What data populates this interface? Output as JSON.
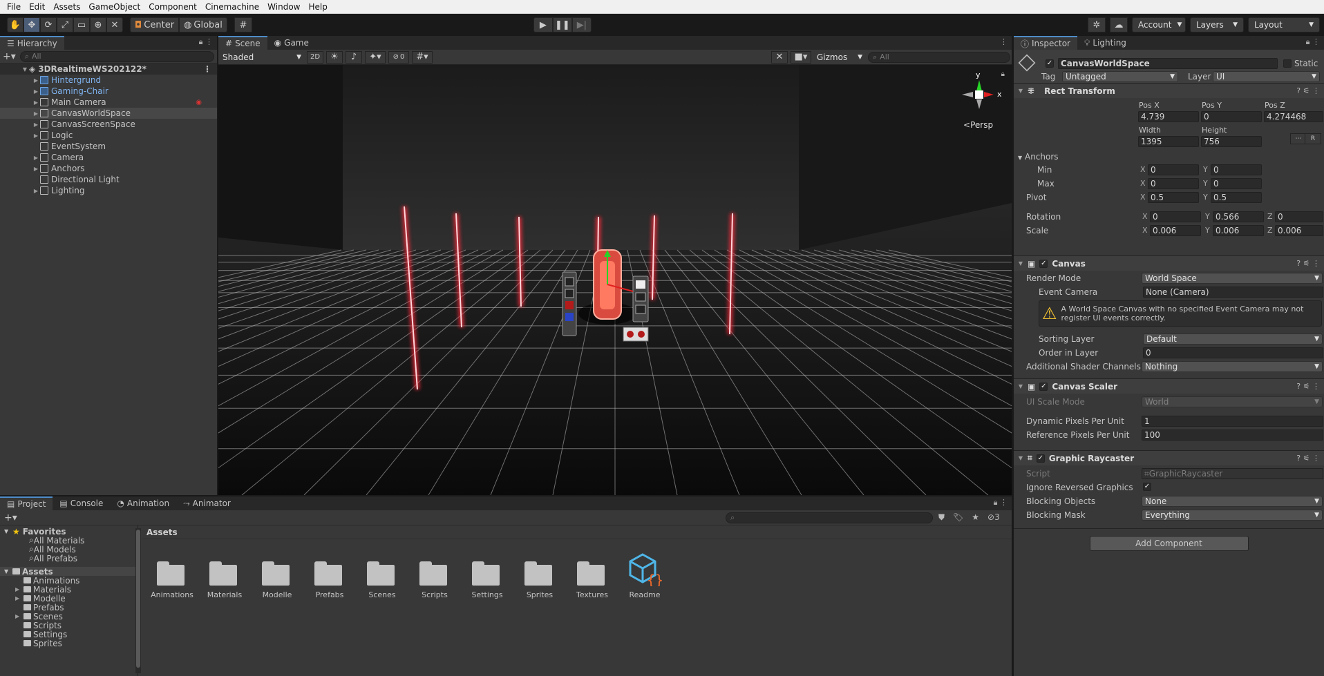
{
  "menubar": [
    "File",
    "Edit",
    "Assets",
    "GameObject",
    "Component",
    "Cinemachine",
    "Window",
    "Help"
  ],
  "toolbar": {
    "pivot": "Center",
    "space": "Global",
    "account": "Account",
    "layers": "Layers",
    "layout": "Layout"
  },
  "hierarchy": {
    "tab": "Hierarchy",
    "search_placeholder": "All",
    "scene": "3DRealtimeWS202122*",
    "items": [
      {
        "label": "Hintergrund",
        "prefab": true
      },
      {
        "label": "Gaming-Chair",
        "prefab": true
      },
      {
        "label": "Main Camera",
        "prefab": false
      },
      {
        "label": "CanvasWorldSpace",
        "prefab": false
      },
      {
        "label": "CanvasScreenSpace",
        "prefab": false
      },
      {
        "label": "Logic",
        "prefab": false
      },
      {
        "label": "EventSystem",
        "prefab": false
      },
      {
        "label": "Camera",
        "prefab": false
      },
      {
        "label": "Anchors",
        "prefab": false
      },
      {
        "label": "Directional Light",
        "prefab": false
      },
      {
        "label": "Lighting",
        "prefab": false
      }
    ]
  },
  "scene": {
    "tab_scene": "Scene",
    "tab_game": "Game",
    "shading": "Shaded",
    "mode2d": "2D",
    "hidden_count": "0",
    "gizmos": "Gizmos",
    "search_placeholder": "All",
    "persp": "Persp",
    "axis_x": "x",
    "axis_y": "y"
  },
  "inspector": {
    "tab": "Inspector",
    "tab2": "Lighting",
    "object_name": "CanvasWorldSpace",
    "static": "Static",
    "tag_label": "Tag",
    "tag": "Untagged",
    "layer_label": "Layer",
    "layer": "UI",
    "rect": {
      "title": "Rect Transform",
      "posx_l": "Pos X",
      "posy_l": "Pos Y",
      "posz_l": "Pos Z",
      "posx": "4.739",
      "posy": "0",
      "posz": "4.274468",
      "width_l": "Width",
      "height_l": "Height",
      "width": "1395",
      "height": "756",
      "r": "R",
      "anchors": "Anchors",
      "min": "Min",
      "max": "Max",
      "min_x": "0",
      "min_y": "0",
      "max_x": "0",
      "max_y": "0",
      "pivot": "Pivot",
      "pivot_x": "0.5",
      "pivot_y": "0.5",
      "rotation": "Rotation",
      "rot_x": "0",
      "rot_y": "0.566",
      "rot_z": "0",
      "scale": "Scale",
      "sc_x": "0.006",
      "sc_y": "0.006",
      "sc_z": "0.006"
    },
    "canvas": {
      "title": "Canvas",
      "render_mode_l": "Render Mode",
      "render_mode": "World Space",
      "event_camera_l": "Event Camera",
      "event_camera": "None (Camera)",
      "warning": "A World Space Canvas with no specified Event Camera may not register UI events correctly.",
      "sorting_layer_l": "Sorting Layer",
      "sorting_layer": "Default",
      "order_l": "Order in Layer",
      "order": "0",
      "shader_l": "Additional Shader Channels",
      "shader": "Nothing"
    },
    "scaler": {
      "title": "Canvas Scaler",
      "ui_scale_l": "UI Scale Mode",
      "ui_scale": "World",
      "dpu_l": "Dynamic Pixels Per Unit",
      "dpu": "1",
      "rpu_l": "Reference Pixels Per Unit",
      "rpu": "100"
    },
    "raycaster": {
      "title": "Graphic Raycaster",
      "script_l": "Script",
      "script": "GraphicRaycaster",
      "ignore_l": "Ignore Reversed Graphics",
      "blocking_l": "Blocking Objects",
      "blocking": "None",
      "mask_l": "Blocking Mask",
      "mask": "Everything"
    },
    "add_component": "Add Component"
  },
  "project": {
    "tabs": [
      "Project",
      "Console",
      "Animation",
      "Animator"
    ],
    "hidden_count": "3",
    "favorites": "Favorites",
    "fav_items": [
      "All Materials",
      "All Models",
      "All Prefabs"
    ],
    "assets": "Assets",
    "asset_tree": [
      "Animations",
      "Materials",
      "Modelle",
      "Prefabs",
      "Scenes",
      "Scripts",
      "Settings",
      "Sprites"
    ],
    "breadcrumb": "Assets",
    "grid": [
      "Animations",
      "Materials",
      "Modelle",
      "Prefabs",
      "Scenes",
      "Scripts",
      "Settings",
      "Sprites",
      "Textures"
    ],
    "readme": "Readme"
  }
}
